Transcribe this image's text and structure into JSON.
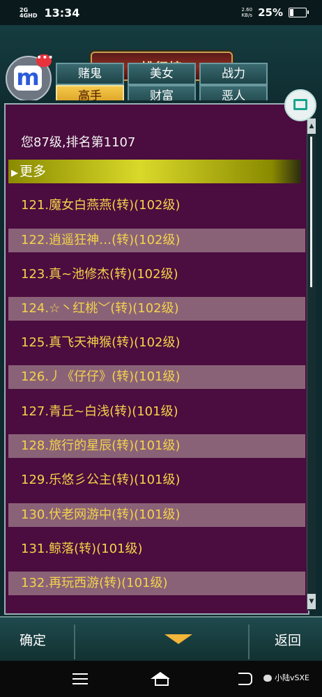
{
  "status_bar": {
    "signal_1": "2G",
    "signal_2": "4GHD",
    "time": "13:34",
    "net_speed_value": "2.60",
    "net_speed_unit": "KB/s",
    "battery": "25%"
  },
  "header": {
    "title": "排行榜",
    "logo_letter": "m",
    "logo_badge": "•••"
  },
  "tabs": [
    {
      "label": "赌鬼",
      "active": false
    },
    {
      "label": "美女",
      "active": false
    },
    {
      "label": "战力",
      "active": false
    },
    {
      "label": "高手",
      "active": true
    },
    {
      "label": "财富",
      "active": false
    },
    {
      "label": "恶人",
      "active": false
    }
  ],
  "panel": {
    "header_text": "您87级,排名第1107",
    "more_label": "更多",
    "rows": [
      "121.魔女白燕燕(转)(102级)",
      "122.逍遥狂神…(转)(102级)",
      "123.真~池修杰(转)(102级)",
      "124.☆丶红桃﹀(转)(102级)",
      "125.真飞天神猴(转)(102级)",
      "126.丿《仔仔》(转)(101级)",
      "127.青丘~白浅(转)(101级)",
      "128.旅行的星辰(转)(101级)",
      "129.乐悠彡公主(转)(101级)",
      "130.伏老网游中(转)(101级)",
      "131.鲸落(转)(101级)",
      "132.再玩西游(转)(101级)"
    ]
  },
  "bottom": {
    "confirm_label": "确定",
    "back_label": "返回"
  },
  "navbar": {
    "watermark": "小陆vSXE"
  }
}
